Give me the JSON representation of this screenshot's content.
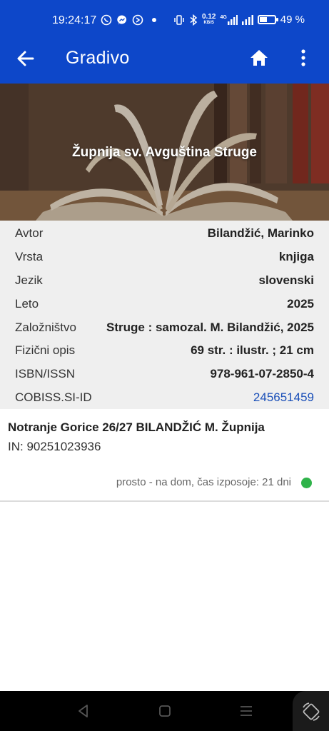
{
  "status_bar": {
    "time": "19:24:17",
    "speed_value": "0.12",
    "speed_unit": "KB/S",
    "network": "4G",
    "battery": "49 %",
    "battery_level": 0.49
  },
  "app_bar": {
    "title": "Gradivo"
  },
  "hero": {
    "library_name": "Župnija sv. Avguština Struge"
  },
  "details": [
    {
      "label": "Avtor",
      "value": "Bilandžić, Marinko"
    },
    {
      "label": "Vrsta",
      "value": "knjiga"
    },
    {
      "label": "Jezik",
      "value": "slovenski"
    },
    {
      "label": "Leto",
      "value": "2025"
    },
    {
      "label": "Založništvo",
      "value": "Struge : samozal. M. Bilandžić, 2025"
    },
    {
      "label": "Fizični opis",
      "value": "69 str. : ilustr. ; 21 cm"
    },
    {
      "label": "ISBN/ISSN",
      "value": "978-961-07-2850-4"
    },
    {
      "label": "COBISS.SI-ID",
      "value": "245651459"
    }
  ],
  "holding": {
    "location": "Notranje Gorice 26/27 BILANDŽIĆ M. Župnija",
    "inventory": "IN: 90251023936",
    "status": "prosto - na dom, čas izposoje: 21 dni",
    "status_color": "#2fb34a"
  },
  "colors": {
    "primary": "#0d47c9",
    "link": "#1a4fb8",
    "details_bg": "#efefef"
  }
}
